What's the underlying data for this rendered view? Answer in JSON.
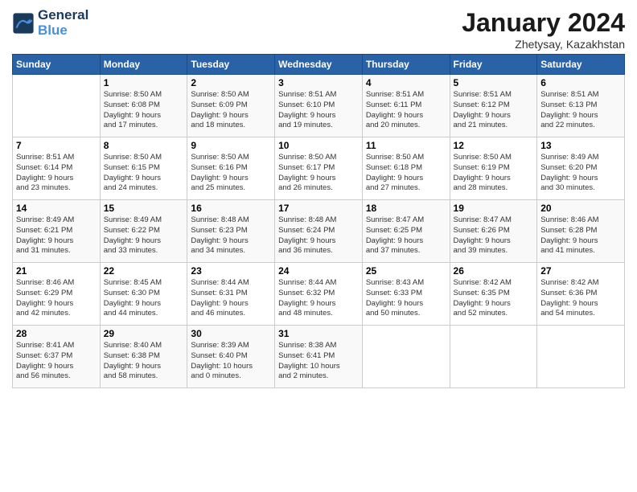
{
  "header": {
    "logo_line1": "General",
    "logo_line2": "Blue",
    "month": "January 2024",
    "location": "Zhetysay, Kazakhstan"
  },
  "weekdays": [
    "Sunday",
    "Monday",
    "Tuesday",
    "Wednesday",
    "Thursday",
    "Friday",
    "Saturday"
  ],
  "weeks": [
    [
      {
        "day": "",
        "info": ""
      },
      {
        "day": "1",
        "info": "Sunrise: 8:50 AM\nSunset: 6:08 PM\nDaylight: 9 hours\nand 17 minutes."
      },
      {
        "day": "2",
        "info": "Sunrise: 8:50 AM\nSunset: 6:09 PM\nDaylight: 9 hours\nand 18 minutes."
      },
      {
        "day": "3",
        "info": "Sunrise: 8:51 AM\nSunset: 6:10 PM\nDaylight: 9 hours\nand 19 minutes."
      },
      {
        "day": "4",
        "info": "Sunrise: 8:51 AM\nSunset: 6:11 PM\nDaylight: 9 hours\nand 20 minutes."
      },
      {
        "day": "5",
        "info": "Sunrise: 8:51 AM\nSunset: 6:12 PM\nDaylight: 9 hours\nand 21 minutes."
      },
      {
        "day": "6",
        "info": "Sunrise: 8:51 AM\nSunset: 6:13 PM\nDaylight: 9 hours\nand 22 minutes."
      }
    ],
    [
      {
        "day": "7",
        "info": "Sunrise: 8:51 AM\nSunset: 6:14 PM\nDaylight: 9 hours\nand 23 minutes."
      },
      {
        "day": "8",
        "info": "Sunrise: 8:50 AM\nSunset: 6:15 PM\nDaylight: 9 hours\nand 24 minutes."
      },
      {
        "day": "9",
        "info": "Sunrise: 8:50 AM\nSunset: 6:16 PM\nDaylight: 9 hours\nand 25 minutes."
      },
      {
        "day": "10",
        "info": "Sunrise: 8:50 AM\nSunset: 6:17 PM\nDaylight: 9 hours\nand 26 minutes."
      },
      {
        "day": "11",
        "info": "Sunrise: 8:50 AM\nSunset: 6:18 PM\nDaylight: 9 hours\nand 27 minutes."
      },
      {
        "day": "12",
        "info": "Sunrise: 8:50 AM\nSunset: 6:19 PM\nDaylight: 9 hours\nand 28 minutes."
      },
      {
        "day": "13",
        "info": "Sunrise: 8:49 AM\nSunset: 6:20 PM\nDaylight: 9 hours\nand 30 minutes."
      }
    ],
    [
      {
        "day": "14",
        "info": "Sunrise: 8:49 AM\nSunset: 6:21 PM\nDaylight: 9 hours\nand 31 minutes."
      },
      {
        "day": "15",
        "info": "Sunrise: 8:49 AM\nSunset: 6:22 PM\nDaylight: 9 hours\nand 33 minutes."
      },
      {
        "day": "16",
        "info": "Sunrise: 8:48 AM\nSunset: 6:23 PM\nDaylight: 9 hours\nand 34 minutes."
      },
      {
        "day": "17",
        "info": "Sunrise: 8:48 AM\nSunset: 6:24 PM\nDaylight: 9 hours\nand 36 minutes."
      },
      {
        "day": "18",
        "info": "Sunrise: 8:47 AM\nSunset: 6:25 PM\nDaylight: 9 hours\nand 37 minutes."
      },
      {
        "day": "19",
        "info": "Sunrise: 8:47 AM\nSunset: 6:26 PM\nDaylight: 9 hours\nand 39 minutes."
      },
      {
        "day": "20",
        "info": "Sunrise: 8:46 AM\nSunset: 6:28 PM\nDaylight: 9 hours\nand 41 minutes."
      }
    ],
    [
      {
        "day": "21",
        "info": "Sunrise: 8:46 AM\nSunset: 6:29 PM\nDaylight: 9 hours\nand 42 minutes."
      },
      {
        "day": "22",
        "info": "Sunrise: 8:45 AM\nSunset: 6:30 PM\nDaylight: 9 hours\nand 44 minutes."
      },
      {
        "day": "23",
        "info": "Sunrise: 8:44 AM\nSunset: 6:31 PM\nDaylight: 9 hours\nand 46 minutes."
      },
      {
        "day": "24",
        "info": "Sunrise: 8:44 AM\nSunset: 6:32 PM\nDaylight: 9 hours\nand 48 minutes."
      },
      {
        "day": "25",
        "info": "Sunrise: 8:43 AM\nSunset: 6:33 PM\nDaylight: 9 hours\nand 50 minutes."
      },
      {
        "day": "26",
        "info": "Sunrise: 8:42 AM\nSunset: 6:35 PM\nDaylight: 9 hours\nand 52 minutes."
      },
      {
        "day": "27",
        "info": "Sunrise: 8:42 AM\nSunset: 6:36 PM\nDaylight: 9 hours\nand 54 minutes."
      }
    ],
    [
      {
        "day": "28",
        "info": "Sunrise: 8:41 AM\nSunset: 6:37 PM\nDaylight: 9 hours\nand 56 minutes."
      },
      {
        "day": "29",
        "info": "Sunrise: 8:40 AM\nSunset: 6:38 PM\nDaylight: 9 hours\nand 58 minutes."
      },
      {
        "day": "30",
        "info": "Sunrise: 8:39 AM\nSunset: 6:40 PM\nDaylight: 10 hours\nand 0 minutes."
      },
      {
        "day": "31",
        "info": "Sunrise: 8:38 AM\nSunset: 6:41 PM\nDaylight: 10 hours\nand 2 minutes."
      },
      {
        "day": "",
        "info": ""
      },
      {
        "day": "",
        "info": ""
      },
      {
        "day": "",
        "info": ""
      }
    ]
  ]
}
